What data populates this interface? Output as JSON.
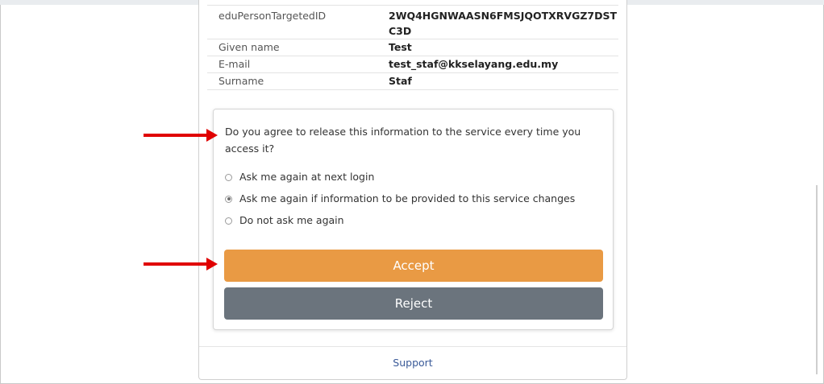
{
  "attributes": {
    "rows": [
      {
        "name": "eduPersonTargetedID",
        "value": "2WQ4HGNWAASN6FMSJQOTXRVGZ7DSTC3D"
      },
      {
        "name": "Given name",
        "value": "Test"
      },
      {
        "name": "E-mail",
        "value": "test_staf@kkselayang.edu.my"
      },
      {
        "name": "Surname",
        "value": "Staf"
      }
    ]
  },
  "consent": {
    "question": "Do you agree to release this information to the service every time you access it?",
    "options": [
      {
        "label": "Ask me again at next login",
        "checked": false
      },
      {
        "label": "Ask me again if information to be provided to this service changes",
        "checked": true
      },
      {
        "label": "Do not ask me again",
        "checked": false
      }
    ],
    "accept_label": "Accept",
    "reject_label": "Reject"
  },
  "footer": {
    "support_label": "Support"
  },
  "colors": {
    "accept": "#e99a44",
    "reject": "#6b747d",
    "annotation_arrow": "#e00000",
    "link": "#3a5a98"
  }
}
